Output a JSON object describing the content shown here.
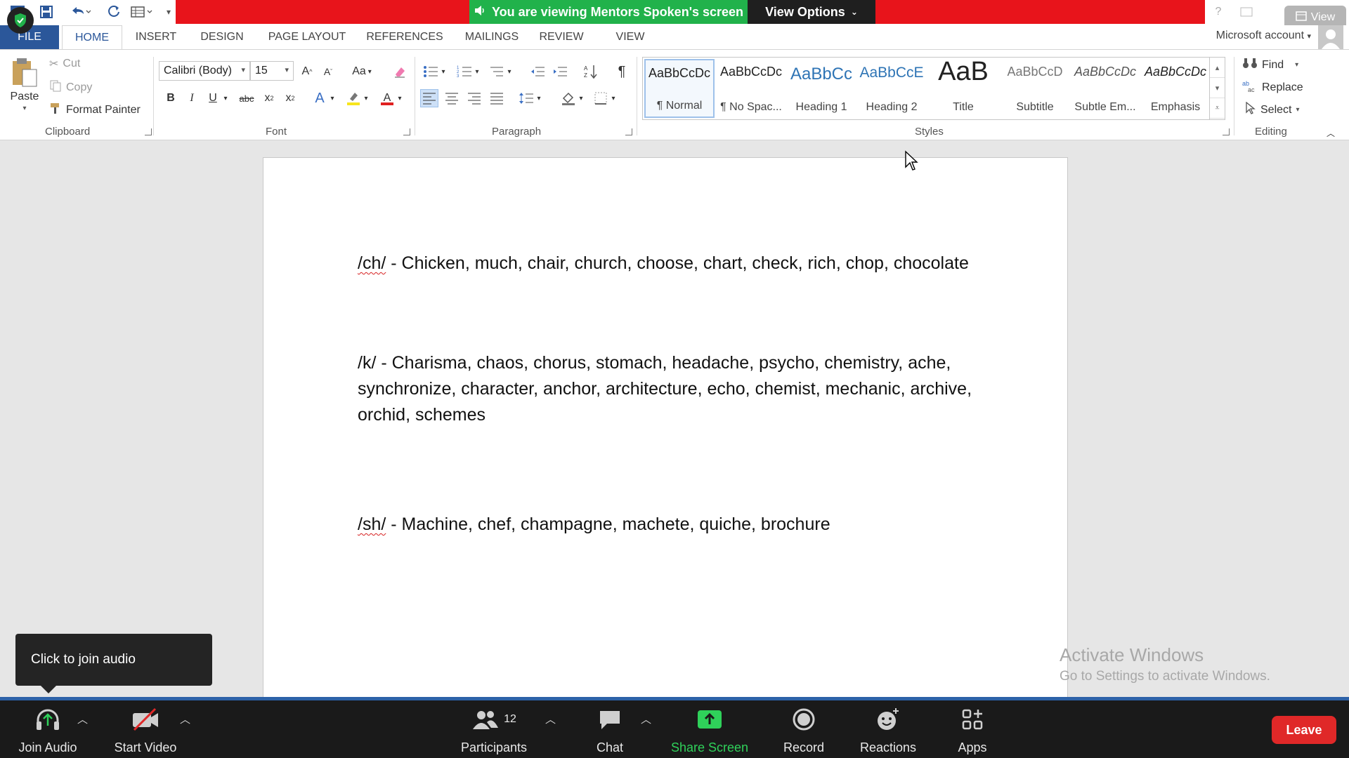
{
  "titlebar": {
    "banner_text": "You are viewing Mentors Spoken's screen",
    "view_options": "View Options",
    "view_button": "View"
  },
  "tabs": {
    "items": [
      "FILE",
      "HOME",
      "INSERT",
      "DESIGN",
      "PAGE LAYOUT",
      "REFERENCES",
      "MAILINGS",
      "REVIEW",
      "VIEW"
    ],
    "active": "HOME",
    "account": "Microsoft account"
  },
  "clipboard": {
    "paste": "Paste",
    "cut": "Cut",
    "copy": "Copy",
    "format_painter": "Format Painter",
    "label": "Clipboard"
  },
  "font": {
    "family": "Calibri (Body)",
    "size": "15",
    "case_button": "Aa",
    "label": "Font"
  },
  "paragraph": {
    "label": "Paragraph"
  },
  "styles": {
    "label": "Styles",
    "items": [
      {
        "sample": "AaBbCcDc",
        "name": "¶ Normal"
      },
      {
        "sample": "AaBbCcDc",
        "name": "¶ No Spac..."
      },
      {
        "sample": "AaBbCc",
        "name": "Heading 1"
      },
      {
        "sample": "AaBbCcE",
        "name": "Heading 2"
      },
      {
        "sample": "AaB",
        "name": "Title"
      },
      {
        "sample": "AaBbCcD",
        "name": "Subtitle"
      },
      {
        "sample": "AaBbCcDc",
        "name": "Subtle Em..."
      },
      {
        "sample": "AaBbCcDc",
        "name": "Emphasis"
      }
    ]
  },
  "editing": {
    "find": "Find",
    "replace": "Replace",
    "select": "Select",
    "label": "Editing"
  },
  "document": {
    "p1_sound": "/ch/",
    "p1_text": " - Chicken, much, chair, church, choose, chart, check, rich, chop, chocolate",
    "p2": "/k/ - Charisma, chaos, chorus, stomach, headache, psycho, chemistry, ache, synchronize, character, anchor, architecture, echo, chemist, mechanic, archive, orchid, schemes",
    "p3_sound": "/sh/",
    "p3_text": " - Machine, chef, champagne, machete, quiche, brochure"
  },
  "watermark": {
    "title": "Activate Windows",
    "subtitle": "Go to Settings to activate Windows."
  },
  "tooltip": {
    "text": "Click to join audio"
  },
  "meeting": {
    "join_audio": "Join Audio",
    "start_video": "Start Video",
    "participants": "Participants",
    "participants_count": "12",
    "chat": "Chat",
    "share_screen": "Share Screen",
    "record": "Record",
    "reactions": "Reactions",
    "apps": "Apps",
    "leave": "Leave"
  },
  "colors": {
    "banner_red": "#e8141b",
    "banner_green": "#21b24b",
    "word_blue": "#2b579a",
    "leave_red": "#e02828",
    "share_green": "#2fd15a"
  }
}
